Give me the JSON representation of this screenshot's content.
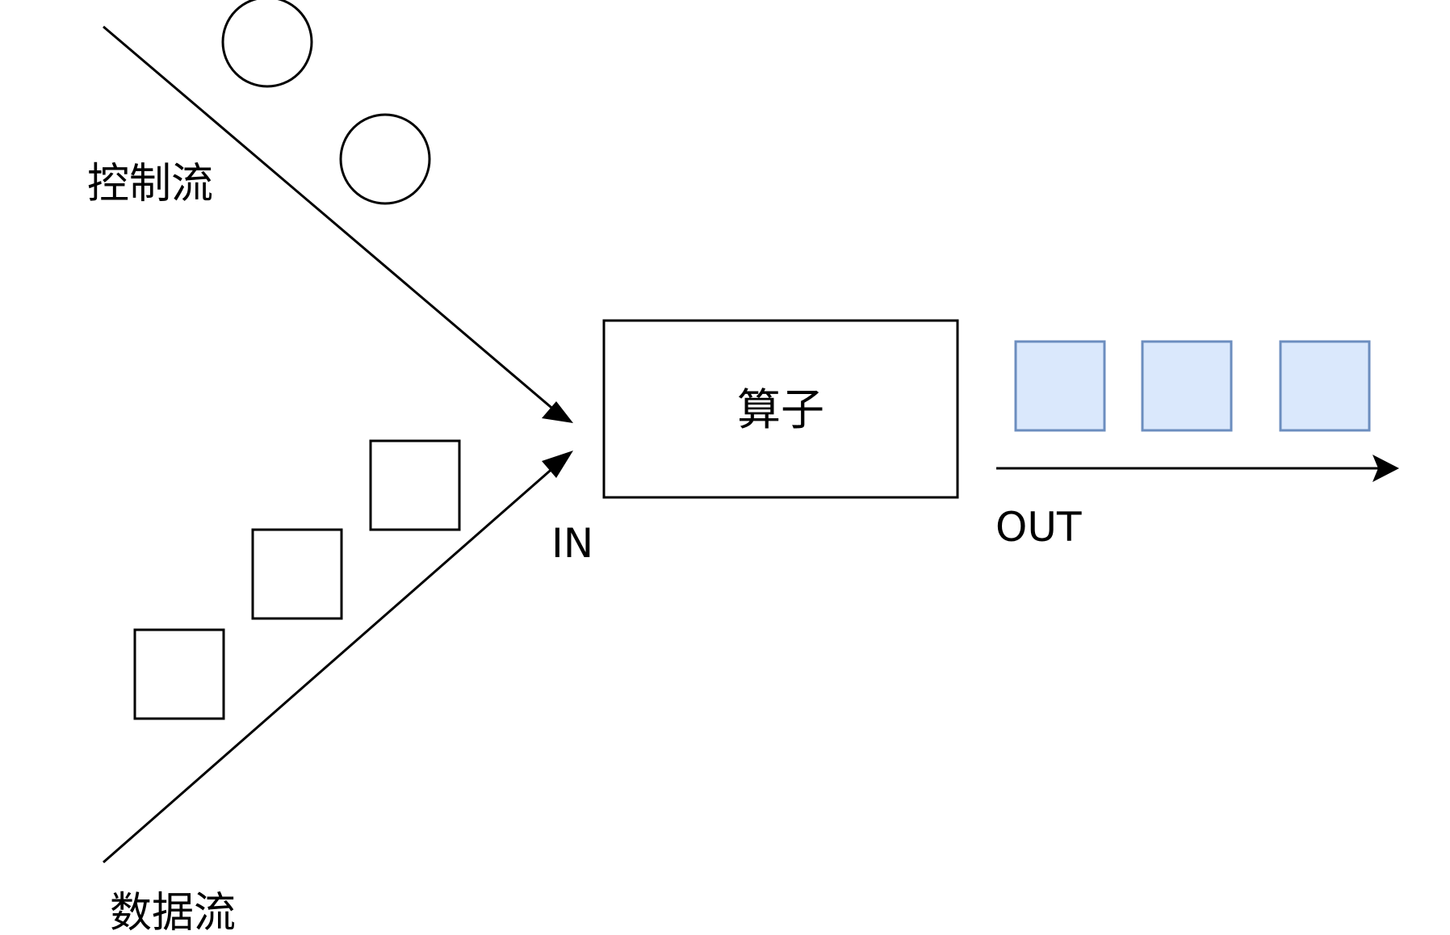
{
  "labels": {
    "control_flow": "控制流",
    "data_flow": "数据流",
    "operator": "算子",
    "input": "IN",
    "output": "OUT"
  },
  "colors": {
    "stroke": "#000000",
    "output_fill": "#dae8fc",
    "output_stroke": "#6c8ebf"
  },
  "icons": {
    "control_token": "circle",
    "data_token": "square"
  }
}
